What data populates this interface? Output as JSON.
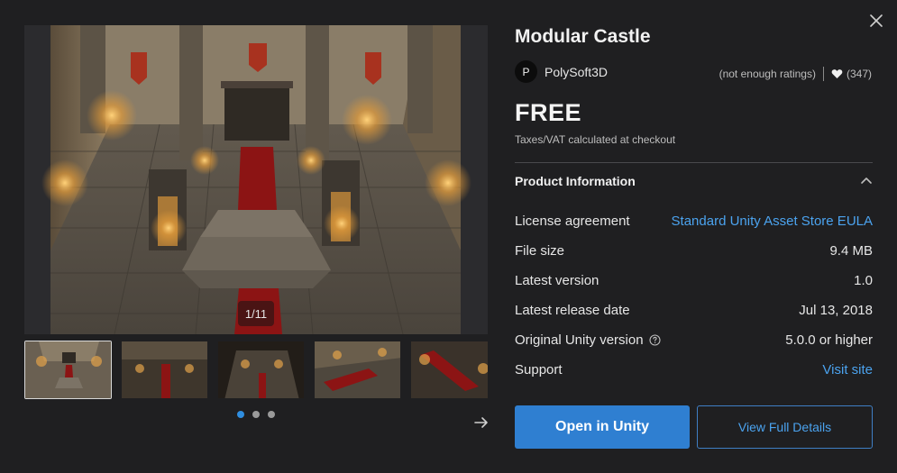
{
  "media": {
    "counter": "1/11",
    "thumbnail_count": 5,
    "active_thumbnail": 1,
    "pagination_dots": 3,
    "active_dot": 1
  },
  "product": {
    "title": "Modular Castle",
    "publisher": {
      "name": "PolySoft3D",
      "avatar_initial": "P"
    },
    "ratings_text": "(not enough ratings)",
    "favorites": "(347)",
    "price": "FREE",
    "tax_note": "Taxes/VAT calculated at checkout"
  },
  "info": {
    "section_title": "Product Information",
    "rows": [
      {
        "label": "License agreement",
        "value": "Standard Unity Asset Store EULA",
        "link": true
      },
      {
        "label": "File size",
        "value": "9.4 MB",
        "link": false
      },
      {
        "label": "Latest version",
        "value": "1.0",
        "link": false
      },
      {
        "label": "Latest release date",
        "value": "Jul 13, 2018",
        "link": false
      },
      {
        "label": "Original Unity version",
        "value": "5.0.0 or higher",
        "link": false,
        "help": true
      },
      {
        "label": "Support",
        "value": "Visit site",
        "link": true
      }
    ]
  },
  "actions": {
    "open_label": "Open in Unity",
    "details_label": "View Full Details"
  },
  "colors": {
    "background": "#1f1f21",
    "accent": "#2f7fd1",
    "link": "#4ba3ef",
    "dot_active": "#2f8ee0"
  },
  "icons": {
    "close": "close-icon",
    "heart": "heart-icon",
    "chevron": "chevron-up-icon",
    "help": "help-circle-icon",
    "next": "arrow-right-icon"
  }
}
